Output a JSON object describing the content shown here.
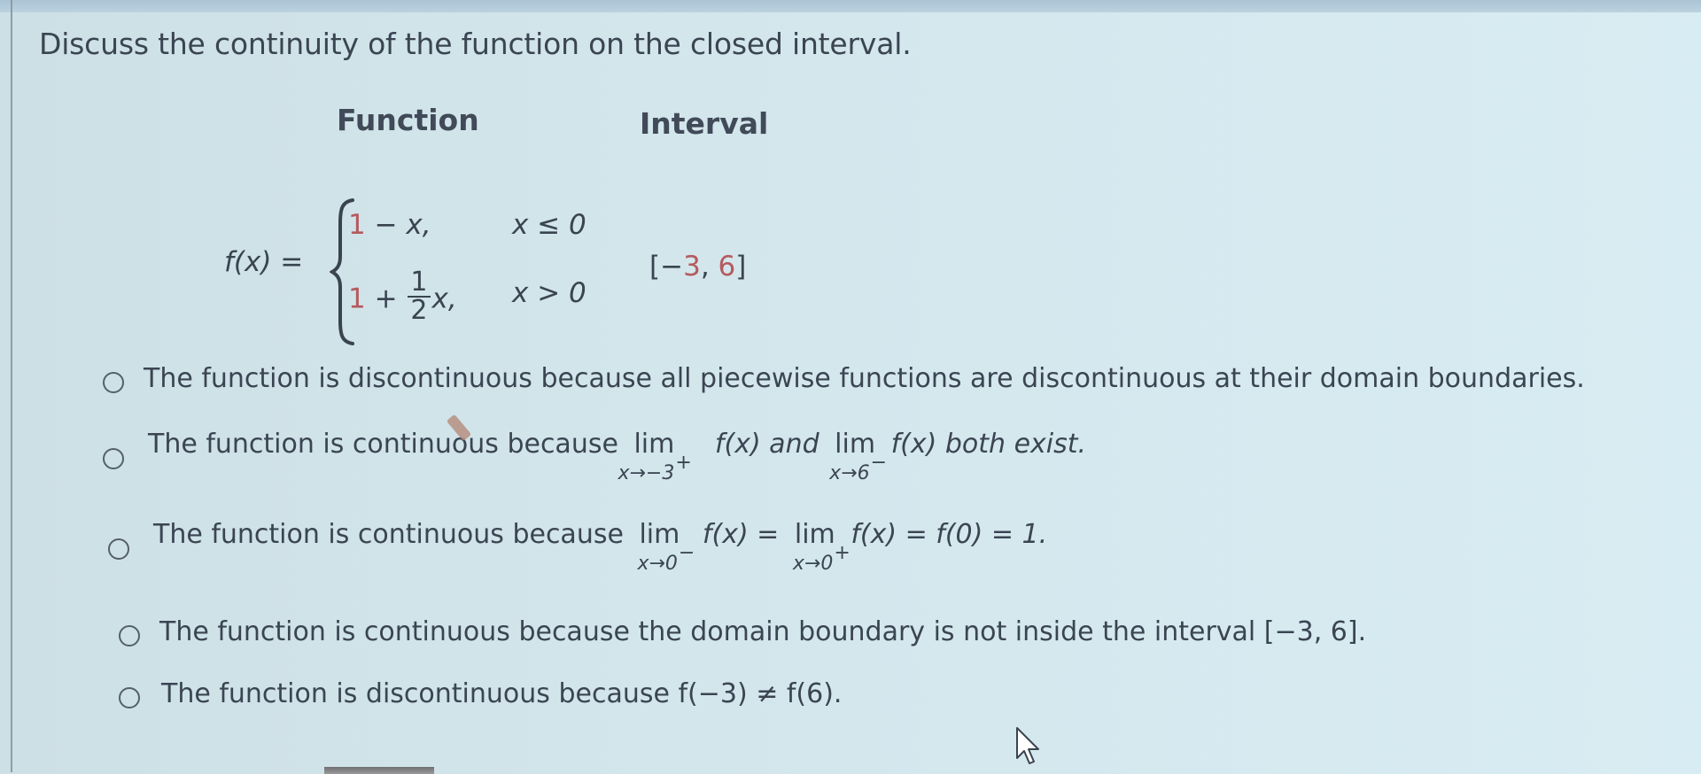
{
  "question": {
    "title": "Discuss the continuity of the function on the closed interval.",
    "column_headers": {
      "function": "Function",
      "interval": "Interval"
    }
  },
  "function": {
    "label": "f(x) =",
    "cases": [
      {
        "expr_const": "1",
        "expr_rest": " − x,",
        "condition": "x ≤ 0"
      },
      {
        "expr_const": "1",
        "expr_op": " + ",
        "frac_num": "1",
        "frac_den": "2",
        "expr_rest": "x,",
        "condition": "x > 0"
      }
    ]
  },
  "interval": {
    "open": "[−",
    "left": "3",
    "sep": ", ",
    "right": "6",
    "close": "]"
  },
  "options": [
    {
      "id": "opt1",
      "selected": false,
      "text": "The function is discontinuous because all piecewise functions are discontinuous at their domain boundaries."
    },
    {
      "id": "opt2",
      "selected": false,
      "prefix": "The function is continuous because",
      "lim1": {
        "word": "lim",
        "sub": "x→−3",
        "sup": "+"
      },
      "mid1": "f(x) and",
      "lim2": {
        "word": "lim",
        "sub": "x→6",
        "sup": "−"
      },
      "suffix": "f(x) both exist."
    },
    {
      "id": "opt3",
      "selected": false,
      "prefix": "The function is continuous because",
      "lim1": {
        "word": "lim",
        "sub": "x→0",
        "sup": "−"
      },
      "mid1": "f(x) =",
      "lim2": {
        "word": "lim",
        "sub": "x→0",
        "sup": "+"
      },
      "suffix": "f(x) = f(0) = 1."
    },
    {
      "id": "opt4",
      "selected": false,
      "text": "The function is continuous because the domain boundary is not inside the interval [−3, 6]."
    },
    {
      "id": "opt5",
      "selected": false,
      "text": "The function is discontinuous because f(−3) ≠ f(6)."
    }
  ],
  "colors": {
    "text": "#3b4552",
    "highlight_numbers": "#b55a5e",
    "background": "#d3e6ec"
  },
  "icons": {
    "cursor": "mouse-pointer-icon",
    "radio": "radio-button-empty"
  }
}
